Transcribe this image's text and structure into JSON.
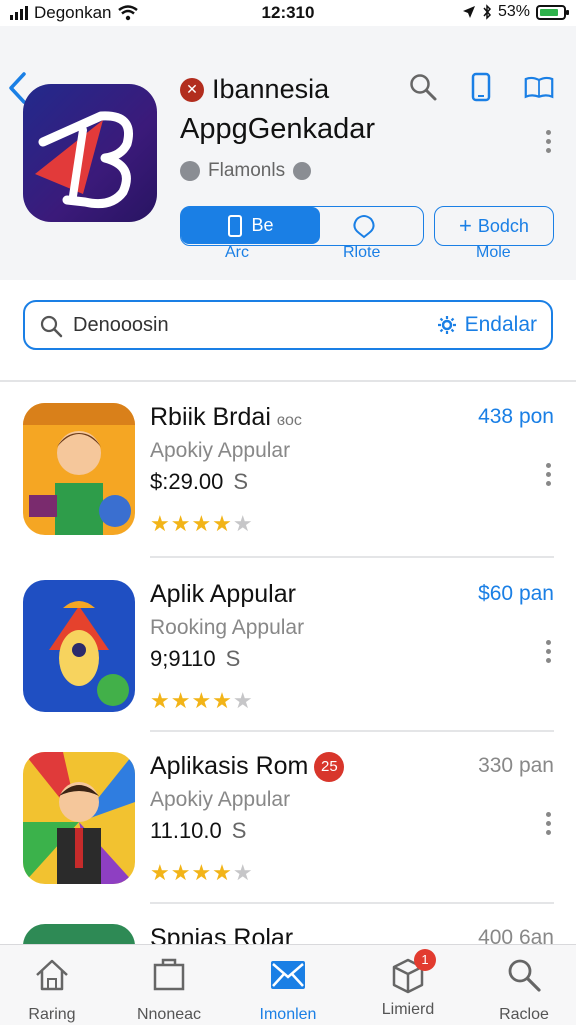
{
  "status_bar": {
    "carrier": "Degonkan",
    "time": "12:310",
    "battery": "53%",
    "battery_level": 0.53
  },
  "header": {
    "developer": "Ibannesia",
    "developer_badge": "✕",
    "app_title": "AppgGenkadar",
    "rating_text": "Flamonls",
    "segments": [
      {
        "top": "Be",
        "bottom": "Arc",
        "active": true
      },
      {
        "top": "",
        "bottom": "Rlote",
        "active": false
      }
    ],
    "add_button": {
      "label": "Bodch",
      "sub": "Mole"
    }
  },
  "search": {
    "placeholder": "Denooosin",
    "action_label": "Endalar"
  },
  "list": [
    {
      "name": "Rbiik Brdai",
      "small": "ɞoc",
      "subtitle": "Apokiy Appular",
      "price": "$:29.00",
      "unit": "S",
      "right": "438 pon",
      "right_color": "#1a7fe5",
      "rating": 4,
      "badge": ""
    },
    {
      "name": "Aplik Appular",
      "small": "",
      "subtitle": "Rooking Appular",
      "price": "9;9110",
      "unit": "S",
      "right": "$60 pan",
      "right_color": "#1a7fe5",
      "rating": 4,
      "badge": ""
    },
    {
      "name": "Aplikasis Rom",
      "small": "",
      "subtitle": "Apokiy Appular",
      "price": "11.10.0",
      "unit": "S",
      "right": "330 pan",
      "right_color": "#888888",
      "rating": 4,
      "badge": "25"
    },
    {
      "name": "Spnias Rolar",
      "small": "",
      "subtitle": "",
      "price": "",
      "unit": "",
      "right": "400 6an",
      "right_color": "#888888",
      "rating": 0,
      "badge": ""
    }
  ],
  "tabbar": {
    "tabs": [
      {
        "label": "Raring",
        "icon": "home-icon",
        "active": false,
        "badge": ""
      },
      {
        "label": "Nnoneac",
        "icon": "folder-icon",
        "active": false,
        "badge": ""
      },
      {
        "label": "Imonlen",
        "icon": "mail-icon",
        "active": true,
        "badge": ""
      },
      {
        "label": "Limierd",
        "icon": "box-icon",
        "active": false,
        "badge": "1"
      },
      {
        "label": "Racloe",
        "icon": "search-icon",
        "active": false,
        "badge": ""
      }
    ]
  },
  "colors": {
    "accent": "#1a7fe5",
    "star": "#f2b418",
    "badge": "#e23b2f"
  }
}
